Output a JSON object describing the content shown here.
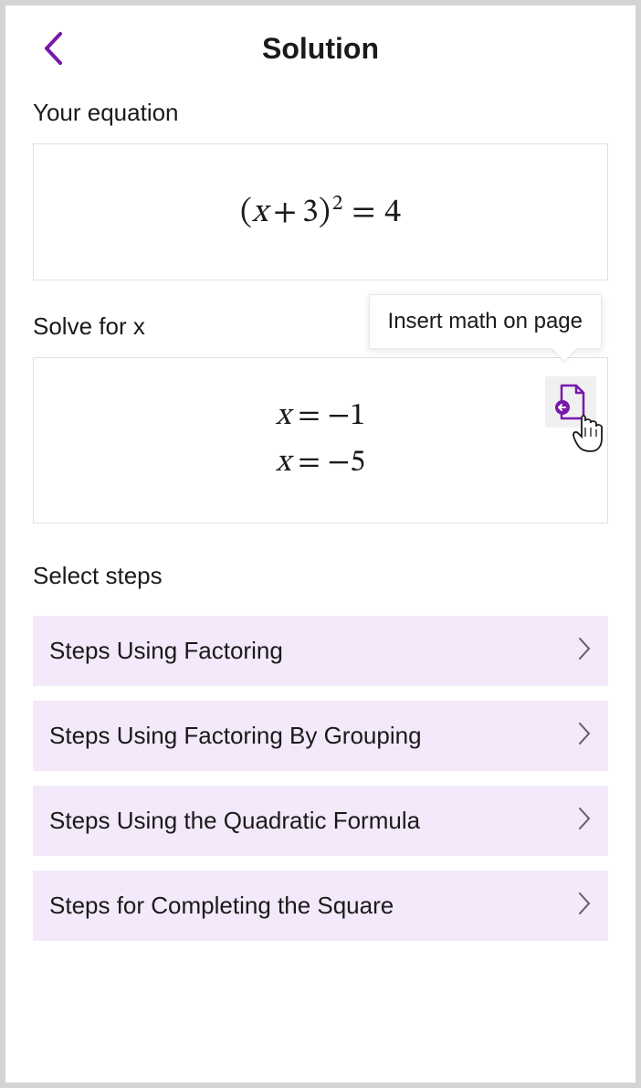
{
  "header": {
    "title": "Solution"
  },
  "sections": {
    "equation_label": "Your equation",
    "solve_label": "Solve for x",
    "select_steps_label": "Select steps"
  },
  "equation": {
    "display": "(x + 3)² = 4",
    "base": "x + 3",
    "exponent": "2",
    "rhs": "4"
  },
  "solutions": {
    "line1_var": "x",
    "line1_val": "−1",
    "line2_var": "x",
    "line2_val": "−5"
  },
  "tooltip": {
    "text": "Insert math on page"
  },
  "steps": [
    {
      "label": "Steps Using Factoring"
    },
    {
      "label": "Steps Using Factoring By Grouping"
    },
    {
      "label": "Steps Using the Quadratic Formula"
    },
    {
      "label": "Steps for Completing the Square"
    }
  ],
  "colors": {
    "accent": "#7719aa",
    "step_bg": "#f3e9fa"
  }
}
